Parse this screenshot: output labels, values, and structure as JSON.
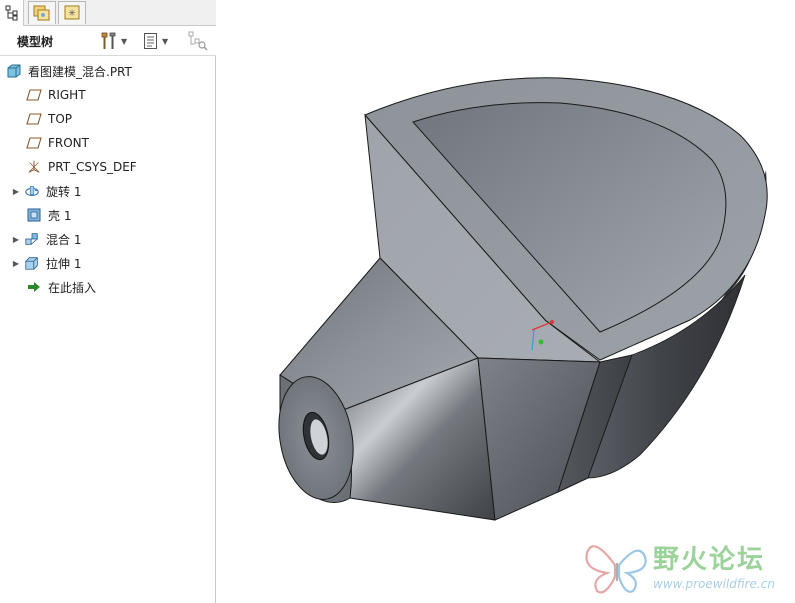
{
  "tabs": [
    {
      "icon": "model-tree-tab-icon"
    },
    {
      "icon": "folder-browser-tab-icon"
    },
    {
      "icon": "favorites-tab-icon"
    }
  ],
  "panel": {
    "title": "模型树",
    "tools": [
      {
        "icon": "settings-tools-icon"
      },
      {
        "icon": "show-list-icon"
      },
      {
        "icon": "filter-icon"
      }
    ]
  },
  "tree": {
    "root": "看图建模_混合.PRT",
    "items": [
      {
        "label": "RIGHT",
        "icon": "datum-plane-icon",
        "expandable": false
      },
      {
        "label": "TOP",
        "icon": "datum-plane-icon",
        "expandable": false
      },
      {
        "label": "FRONT",
        "icon": "datum-plane-icon",
        "expandable": false
      },
      {
        "label": "PRT_CSYS_DEF",
        "icon": "coordinate-system-icon",
        "expandable": false
      },
      {
        "label": "旋转 1",
        "icon": "revolve-icon",
        "expandable": true
      },
      {
        "label": "壳 1",
        "icon": "shell-icon",
        "expandable": false
      },
      {
        "label": "混合 1",
        "icon": "blend-icon",
        "expandable": true
      },
      {
        "label": "拉伸 1",
        "icon": "extrude-icon",
        "expandable": true
      },
      {
        "label": "在此插入",
        "icon": "insert-here-arrow-icon",
        "expandable": false
      }
    ]
  },
  "colors": {
    "model_light": "#a7abb3",
    "model_mid": "#8a8e96",
    "model_dark": "#4a4d53",
    "edge": "#1a1a1a",
    "accent_green": "#2a8a2a"
  },
  "watermark": {
    "cn": "野火论坛",
    "url": "www.proewildfire.cn"
  }
}
